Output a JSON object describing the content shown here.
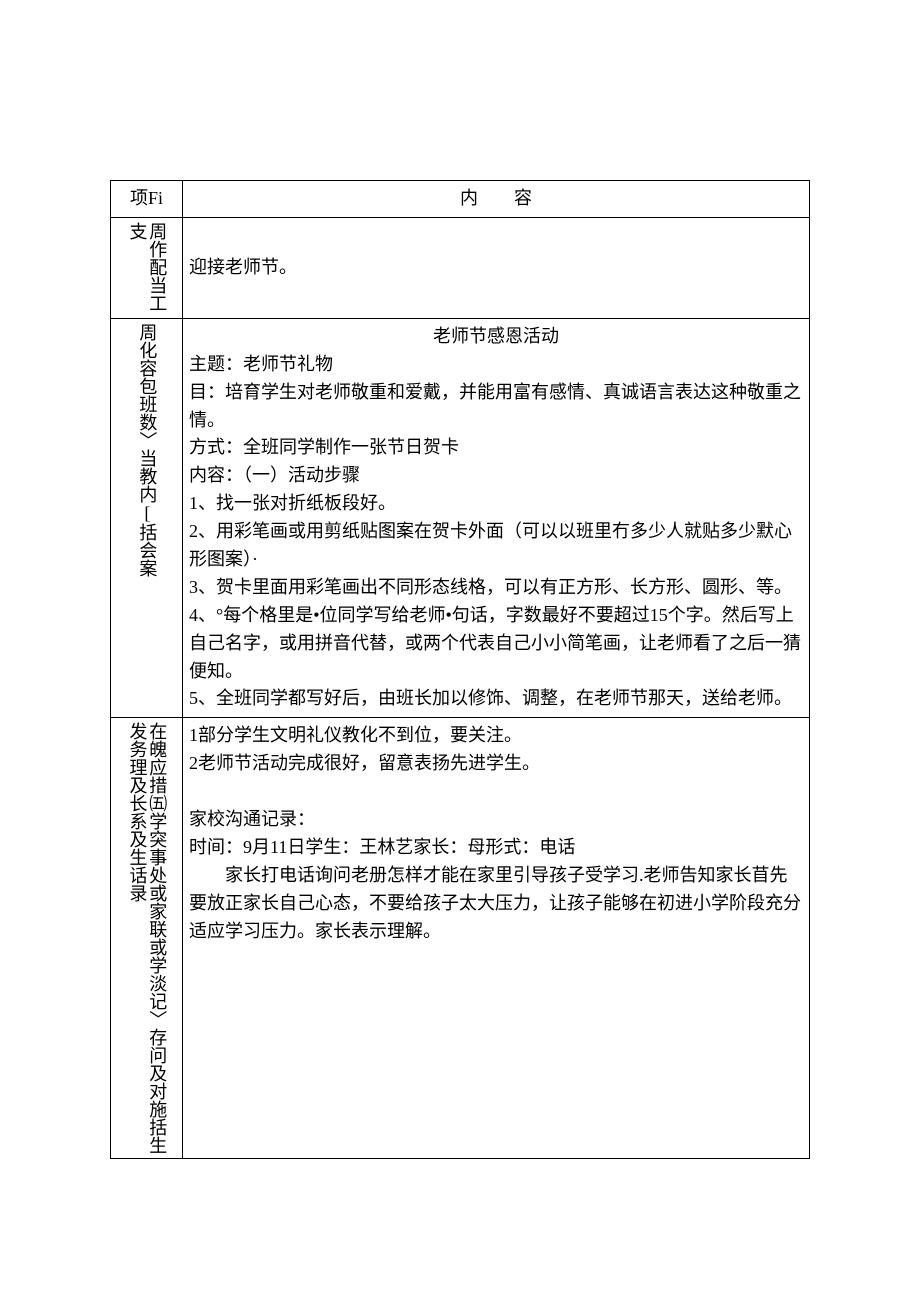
{
  "header": {
    "col1": "项Fi",
    "col2": "内容"
  },
  "row1": {
    "label_c1": "支",
    "label_c2": "周作配当工",
    "content": "迎接老师节。"
  },
  "row2": {
    "label_c1": "周化容包班数〉当教内[括会案",
    "activity_title": "老师节感恩活动",
    "line_theme": "主题：老师节礼物",
    "line_goal": "目：培育学生对老师敬重和爱戴，并能用富有感情、真诚语言表达这种敬重之情。",
    "line_method": "方式：全班同学制作一张节日贺卡",
    "line_content_hdr": "内容：（一）活动步骤",
    "step1": "1、找一张对折纸板段好。",
    "step2": "2、用彩笔画或用剪纸贴图案在贺卡外面（可以以班里冇多少人就贴多少默心形图案）·",
    "step3": "3、贺卡里面用彩笔画出不同形态线格，可以有正方形、长方形、圆形、等。",
    "step4": "4、°每个格里是•位同学写给老师•句话，字数最好不要超过15个字。然后写上自己名字，或用拼音代替，或两个代表自己小小简笔画，让老师看了之后一猜便知。",
    "step5": "5、全班同学都写好后，由班长加以修饰、调整，在老师节那天，送给老师。"
  },
  "row3": {
    "label_c1": "发务理及长系及生话录",
    "label_c2": "在魄应措㈤学突事处或家联或学淡记〉存问及对施括生",
    "line1": "1部分学生文明礼仪教化不到位，要关注。",
    "line2": "2老师节活动完成很好，留意表扬先进学生。",
    "rec_hdr": "家校沟通记录：",
    "rec_meta": "时间：9月11日学生：王林艺家长：母形式：电话",
    "rec_body": "家长打电话询问老册怎样才能在家里引导孩子受学习.老师告知家长苜先要放正家长自己心态，不要给孩子太大压力，让孩子能够在初进小学阶段充分适应学习压力。家长表示理解。"
  }
}
